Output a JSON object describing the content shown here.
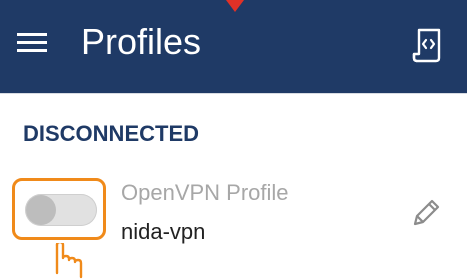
{
  "header": {
    "title": "Profiles",
    "menu_icon": "hamburger-menu-icon",
    "action_icon": "import-profile-icon",
    "colors": {
      "background": "#1f3a66",
      "text": "#ffffff",
      "marker": "#e03127"
    }
  },
  "status": {
    "label": "DISCONNECTED",
    "color": "#1f3a66"
  },
  "profile": {
    "type": "OpenVPN Profile",
    "name": "nida-vpn",
    "connected": false,
    "edit_icon": "pencil-icon",
    "highlight_color": "#f08a1a"
  },
  "cursor": {
    "icon": "hand-pointer-icon",
    "color": "#f08a1a"
  }
}
